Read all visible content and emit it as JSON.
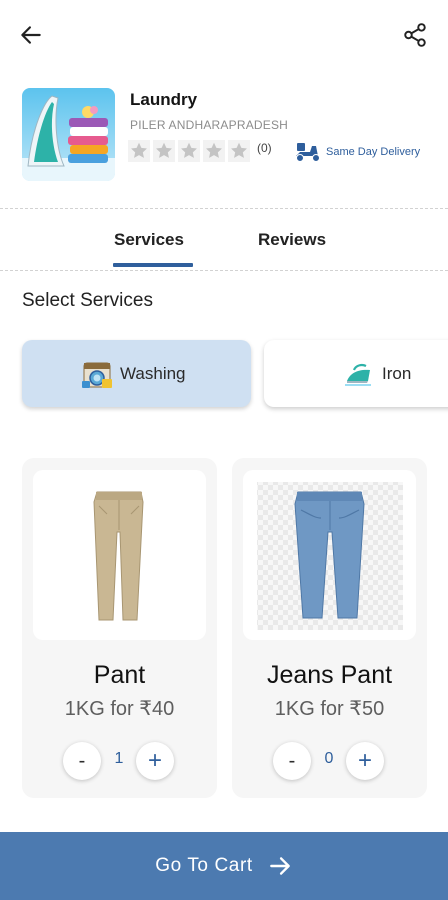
{
  "header": {
    "back_icon": "arrow-left-icon",
    "share_icon": "share-icon"
  },
  "store": {
    "name": "Laundry",
    "location": "PILER ANDHARAPRADESH",
    "rating_count": "(0)",
    "rating_stars": 0,
    "rating_max": 5,
    "delivery_label": "Same Day Delivery",
    "star_color": "#c4c4c4",
    "delivery_color": "#2e5e9c"
  },
  "tabs": [
    {
      "label": "Services",
      "active": true
    },
    {
      "label": "Reviews",
      "active": false
    }
  ],
  "services_section": {
    "title": "Select Services",
    "chips": [
      {
        "label": "Washing",
        "icon": "washing-machine-icon",
        "selected": true
      },
      {
        "label": "Iron",
        "icon": "iron-icon",
        "selected": false
      }
    ]
  },
  "products": [
    {
      "name": "Pant",
      "price": "1KG for ₹40",
      "quantity": "1",
      "minus": "-",
      "plus": "+",
      "image": "khaki-pant-image"
    },
    {
      "name": "Jeans Pant",
      "price": "1KG for ₹50",
      "quantity": "0",
      "minus": "-",
      "plus": "+",
      "image": "jeans-image"
    }
  ],
  "footer": {
    "cart_label": "Go To Cart",
    "cart_icon": "arrow-right-icon"
  },
  "colors": {
    "accent": "#2f5f9c",
    "cart_bar": "#4c7ab0",
    "chip_selected": "#cfe0f2",
    "card_bg": "#f6f6f6"
  }
}
